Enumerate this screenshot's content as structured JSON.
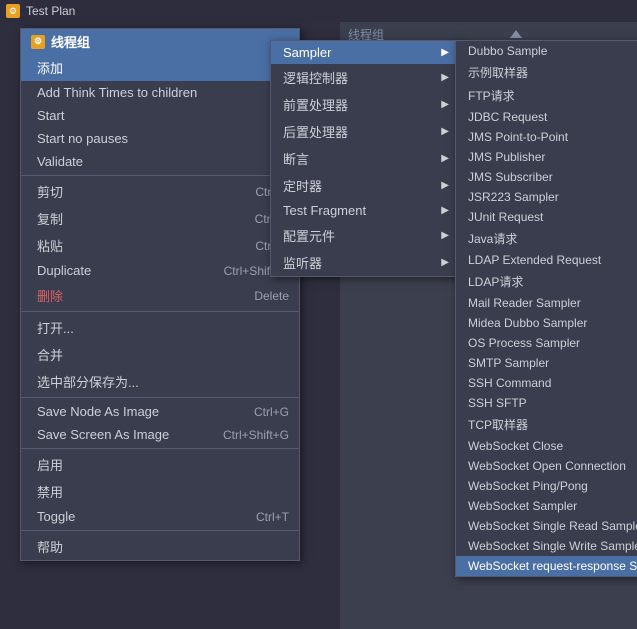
{
  "app": {
    "title": "Test Plan",
    "icon": "gear",
    "right_label": "线程组"
  },
  "menu1": {
    "header": "线程组",
    "items": [
      {
        "label": "添加",
        "shortcut": "",
        "arrow": true,
        "type": "highlighted"
      },
      {
        "label": "Add Think Times to children",
        "shortcut": "",
        "arrow": false,
        "type": "normal"
      },
      {
        "label": "Start",
        "shortcut": "",
        "arrow": false,
        "type": "normal"
      },
      {
        "label": "Start no pauses",
        "shortcut": "",
        "arrow": false,
        "type": "normal"
      },
      {
        "label": "Validate",
        "shortcut": "",
        "arrow": false,
        "type": "normal"
      },
      {
        "label": "divider"
      },
      {
        "label": "剪切",
        "shortcut": "Ctrl+X",
        "arrow": false,
        "type": "normal"
      },
      {
        "label": "复制",
        "shortcut": "Ctrl+C",
        "arrow": false,
        "type": "normal"
      },
      {
        "label": "粘贴",
        "shortcut": "Ctrl+V",
        "arrow": false,
        "type": "normal"
      },
      {
        "label": "Duplicate",
        "shortcut": "Ctrl+Shift+C",
        "arrow": false,
        "type": "normal"
      },
      {
        "label": "删除",
        "shortcut": "Delete",
        "arrow": false,
        "type": "delete"
      },
      {
        "label": "divider"
      },
      {
        "label": "打开...",
        "shortcut": "",
        "arrow": false,
        "type": "normal"
      },
      {
        "label": "合并",
        "shortcut": "",
        "arrow": false,
        "type": "normal"
      },
      {
        "label": "选中部分保存为...",
        "shortcut": "",
        "arrow": false,
        "type": "normal"
      },
      {
        "label": "divider"
      },
      {
        "label": "Save Node As Image",
        "shortcut": "Ctrl+G",
        "arrow": false,
        "type": "normal"
      },
      {
        "label": "Save Screen As Image",
        "shortcut": "Ctrl+Shift+G",
        "arrow": false,
        "type": "normal"
      },
      {
        "label": "divider"
      },
      {
        "label": "启用",
        "shortcut": "",
        "arrow": false,
        "type": "normal"
      },
      {
        "label": "禁用",
        "shortcut": "",
        "arrow": false,
        "type": "normal"
      },
      {
        "label": "Toggle",
        "shortcut": "Ctrl+T",
        "arrow": false,
        "type": "normal"
      },
      {
        "label": "divider"
      },
      {
        "label": "帮助",
        "shortcut": "",
        "arrow": false,
        "type": "normal"
      }
    ]
  },
  "menu2": {
    "items": [
      {
        "label": "Sampler",
        "arrow": true,
        "active": true
      },
      {
        "label": "逻辑控制器",
        "arrow": true
      },
      {
        "label": "前置处理器",
        "arrow": true
      },
      {
        "label": "后置处理器",
        "arrow": true
      },
      {
        "label": "断言",
        "arrow": true
      },
      {
        "label": "定时器",
        "arrow": true
      },
      {
        "label": "Test Fragment",
        "arrow": true
      },
      {
        "label": "配置元件",
        "arrow": true
      },
      {
        "label": "监听器",
        "arrow": true
      }
    ]
  },
  "menu3": {
    "items": [
      {
        "label": "Dubbo Sample",
        "selected": false
      },
      {
        "label": "示例取样器",
        "selected": false
      },
      {
        "label": "FTP请求",
        "selected": false
      },
      {
        "label": "JDBC Request",
        "selected": false
      },
      {
        "label": "JMS Point-to-Point",
        "selected": false
      },
      {
        "label": "JMS Publisher",
        "selected": false
      },
      {
        "label": "JMS Subscriber",
        "selected": false
      },
      {
        "label": "JSR223 Sampler",
        "selected": false
      },
      {
        "label": "JUnit Request",
        "selected": false
      },
      {
        "label": "Java请求",
        "selected": false
      },
      {
        "label": "LDAP Extended Request",
        "selected": false
      },
      {
        "label": "LDAP请求",
        "selected": false
      },
      {
        "label": "Mail Reader Sampler",
        "selected": false
      },
      {
        "label": "Midea Dubbo Sampler",
        "selected": false
      },
      {
        "label": "OS Process Sampler",
        "selected": false
      },
      {
        "label": "SMTP Sampler",
        "selected": false
      },
      {
        "label": "SSH Command",
        "selected": false
      },
      {
        "label": "SSH SFTP",
        "selected": false
      },
      {
        "label": "TCP取样器",
        "selected": false
      },
      {
        "label": "WebSocket Close",
        "selected": false
      },
      {
        "label": "WebSocket Open Connection",
        "selected": false
      },
      {
        "label": "WebSocket Ping/Pong",
        "selected": false
      },
      {
        "label": "WebSocket Sampler",
        "selected": false
      },
      {
        "label": "WebSocket Single Read Sampler",
        "selected": false
      },
      {
        "label": "WebSocket Single Write Sampler",
        "selected": false
      },
      {
        "label": "WebSocket request-response Sampler",
        "selected": true
      }
    ]
  }
}
